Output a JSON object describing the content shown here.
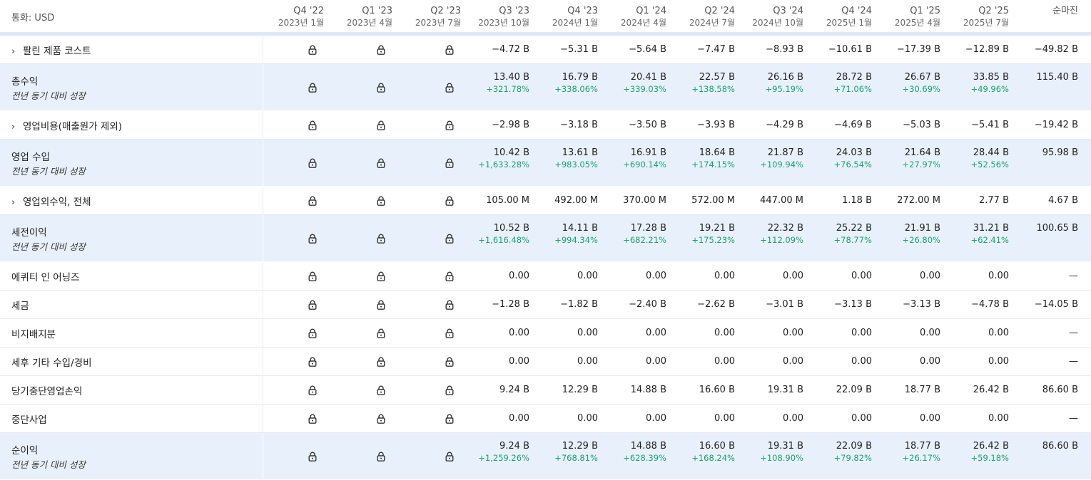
{
  "currency_label": "통화: USD",
  "colors": {
    "growth_text": "#1a9f6e",
    "highlight_row": "#e8f1fb",
    "header_divider": "#dde9f6"
  },
  "lock_icon": "lock-icon",
  "columns": [
    {
      "name": "Q4 '22",
      "date": "2023년 1월"
    },
    {
      "name": "Q1 '23",
      "date": "2023년 4월"
    },
    {
      "name": "Q2 '23",
      "date": "2023년 7월"
    },
    {
      "name": "Q3 '23",
      "date": "2023년 10월"
    },
    {
      "name": "Q4 '23",
      "date": "2024년 1월"
    },
    {
      "name": "Q1 '24",
      "date": "2024년 4월"
    },
    {
      "name": "Q2 '24",
      "date": "2024년 7월"
    },
    {
      "name": "Q3 '24",
      "date": "2024년 10월"
    },
    {
      "name": "Q4 '24",
      "date": "2025년 1월"
    },
    {
      "name": "Q1 '25",
      "date": "2025년 4월"
    },
    {
      "name": "Q2 '25",
      "date": "2025년 7월"
    }
  ],
  "ttm_label": "순마진",
  "rows": [
    {
      "label": "팔린 제품 코스트",
      "expandable": true,
      "values": [
        "−4.72 B",
        "−5.31 B",
        "−5.64 B",
        "−7.47 B",
        "−8.93 B",
        "−10.61 B",
        "−17.39 B",
        "−12.89 B"
      ],
      "ttm": "−49.82 B"
    },
    {
      "label": "총수익",
      "sublabel": "전년 동기 대비 성장",
      "values": [
        "13.40 B",
        "16.79 B",
        "20.41 B",
        "22.57 B",
        "26.16 B",
        "28.72 B",
        "26.67 B",
        "33.85 B"
      ],
      "growth": [
        "+321.78%",
        "+338.06%",
        "+339.03%",
        "+138.58%",
        "+95.19%",
        "+71.06%",
        "+30.69%",
        "+49.96%"
      ],
      "ttm": "115.40 B"
    },
    {
      "label": "영업비용(매출원가 제외)",
      "expandable": true,
      "values": [
        "−2.98 B",
        "−3.18 B",
        "−3.50 B",
        "−3.93 B",
        "−4.29 B",
        "−4.69 B",
        "−5.03 B",
        "−5.41 B"
      ],
      "ttm": "−19.42 B"
    },
    {
      "label": "영업 수입",
      "sublabel": "전년 동기 대비 성장",
      "values": [
        "10.42 B",
        "13.61 B",
        "16.91 B",
        "18.64 B",
        "21.87 B",
        "24.03 B",
        "21.64 B",
        "28.44 B"
      ],
      "growth": [
        "+1,633.28%",
        "+983.05%",
        "+690.14%",
        "+174.15%",
        "+109.94%",
        "+76.54%",
        "+27.97%",
        "+52.56%"
      ],
      "ttm": "95.98 B"
    },
    {
      "label": "영업외수익, 전체",
      "expandable": true,
      "values": [
        "105.00 M",
        "492.00 M",
        "370.00 M",
        "572.00 M",
        "447.00 M",
        "1.18 B",
        "272.00 M",
        "2.77 B"
      ],
      "ttm": "4.67 B"
    },
    {
      "label": "세전이익",
      "sublabel": "전년 동기 대비 성장",
      "values": [
        "10.52 B",
        "14.11 B",
        "17.28 B",
        "19.21 B",
        "22.32 B",
        "25.22 B",
        "21.91 B",
        "31.21 B"
      ],
      "growth": [
        "+1,616.48%",
        "+994.34%",
        "+682.21%",
        "+175.23%",
        "+112.09%",
        "+78.77%",
        "+26.80%",
        "+62.41%"
      ],
      "ttm": "100.65 B"
    },
    {
      "label": "에퀴티 인 어닝즈",
      "values": [
        "0.00",
        "0.00",
        "0.00",
        "0.00",
        "0.00",
        "0.00",
        "0.00",
        "0.00"
      ],
      "ttm": "—"
    },
    {
      "label": "세금",
      "values": [
        "−1.28 B",
        "−1.82 B",
        "−2.40 B",
        "−2.62 B",
        "−3.01 B",
        "−3.13 B",
        "−3.13 B",
        "−4.78 B"
      ],
      "ttm": "−14.05 B"
    },
    {
      "label": "비지배지분",
      "values": [
        "0.00",
        "0.00",
        "0.00",
        "0.00",
        "0.00",
        "0.00",
        "0.00",
        "0.00"
      ],
      "ttm": "—"
    },
    {
      "label": "세후 기타 수입/경비",
      "values": [
        "0.00",
        "0.00",
        "0.00",
        "0.00",
        "0.00",
        "0.00",
        "0.00",
        "0.00"
      ],
      "ttm": "—"
    },
    {
      "label": "당기중단영업손익",
      "values": [
        "9.24 B",
        "12.29 B",
        "14.88 B",
        "16.60 B",
        "19.31 B",
        "22.09 B",
        "18.77 B",
        "26.42 B"
      ],
      "ttm": "86.60 B"
    },
    {
      "label": "중단사업",
      "values": [
        "0.00",
        "0.00",
        "0.00",
        "0.00",
        "0.00",
        "0.00",
        "0.00",
        "0.00"
      ],
      "ttm": "—"
    },
    {
      "label": "순이익",
      "sublabel": "전년 동기 대비 성장",
      "values": [
        "9.24 B",
        "12.29 B",
        "14.88 B",
        "16.60 B",
        "19.31 B",
        "22.09 B",
        "18.77 B",
        "26.42 B"
      ],
      "growth": [
        "+1,259.26%",
        "+768.81%",
        "+628.39%",
        "+168.24%",
        "+108.90%",
        "+79.82%",
        "+26.17%",
        "+59.18%"
      ],
      "ttm": "86.60 B"
    }
  ]
}
